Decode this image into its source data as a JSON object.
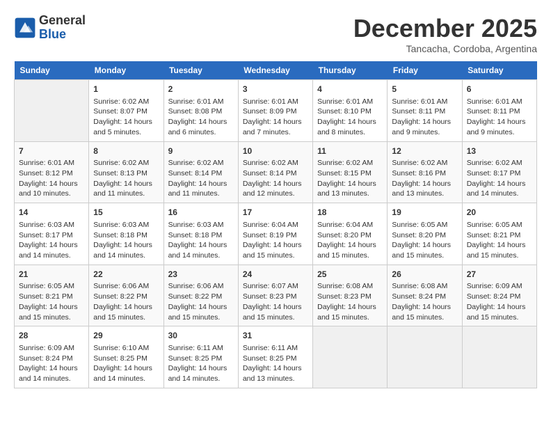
{
  "header": {
    "logo_line1": "General",
    "logo_line2": "Blue",
    "month": "December 2025",
    "location": "Tancacha, Cordoba, Argentina"
  },
  "weekdays": [
    "Sunday",
    "Monday",
    "Tuesday",
    "Wednesday",
    "Thursday",
    "Friday",
    "Saturday"
  ],
  "weeks": [
    [
      {
        "day": "",
        "info": ""
      },
      {
        "day": "1",
        "info": "Sunrise: 6:02 AM\nSunset: 8:07 PM\nDaylight: 14 hours\nand 5 minutes."
      },
      {
        "day": "2",
        "info": "Sunrise: 6:01 AM\nSunset: 8:08 PM\nDaylight: 14 hours\nand 6 minutes."
      },
      {
        "day": "3",
        "info": "Sunrise: 6:01 AM\nSunset: 8:09 PM\nDaylight: 14 hours\nand 7 minutes."
      },
      {
        "day": "4",
        "info": "Sunrise: 6:01 AM\nSunset: 8:10 PM\nDaylight: 14 hours\nand 8 minutes."
      },
      {
        "day": "5",
        "info": "Sunrise: 6:01 AM\nSunset: 8:11 PM\nDaylight: 14 hours\nand 9 minutes."
      },
      {
        "day": "6",
        "info": "Sunrise: 6:01 AM\nSunset: 8:11 PM\nDaylight: 14 hours\nand 9 minutes."
      }
    ],
    [
      {
        "day": "7",
        "info": "Sunrise: 6:01 AM\nSunset: 8:12 PM\nDaylight: 14 hours\nand 10 minutes."
      },
      {
        "day": "8",
        "info": "Sunrise: 6:02 AM\nSunset: 8:13 PM\nDaylight: 14 hours\nand 11 minutes."
      },
      {
        "day": "9",
        "info": "Sunrise: 6:02 AM\nSunset: 8:14 PM\nDaylight: 14 hours\nand 11 minutes."
      },
      {
        "day": "10",
        "info": "Sunrise: 6:02 AM\nSunset: 8:14 PM\nDaylight: 14 hours\nand 12 minutes."
      },
      {
        "day": "11",
        "info": "Sunrise: 6:02 AM\nSunset: 8:15 PM\nDaylight: 14 hours\nand 13 minutes."
      },
      {
        "day": "12",
        "info": "Sunrise: 6:02 AM\nSunset: 8:16 PM\nDaylight: 14 hours\nand 13 minutes."
      },
      {
        "day": "13",
        "info": "Sunrise: 6:02 AM\nSunset: 8:17 PM\nDaylight: 14 hours\nand 14 minutes."
      }
    ],
    [
      {
        "day": "14",
        "info": "Sunrise: 6:03 AM\nSunset: 8:17 PM\nDaylight: 14 hours\nand 14 minutes."
      },
      {
        "day": "15",
        "info": "Sunrise: 6:03 AM\nSunset: 8:18 PM\nDaylight: 14 hours\nand 14 minutes."
      },
      {
        "day": "16",
        "info": "Sunrise: 6:03 AM\nSunset: 8:18 PM\nDaylight: 14 hours\nand 14 minutes."
      },
      {
        "day": "17",
        "info": "Sunrise: 6:04 AM\nSunset: 8:19 PM\nDaylight: 14 hours\nand 15 minutes."
      },
      {
        "day": "18",
        "info": "Sunrise: 6:04 AM\nSunset: 8:20 PM\nDaylight: 14 hours\nand 15 minutes."
      },
      {
        "day": "19",
        "info": "Sunrise: 6:05 AM\nSunset: 8:20 PM\nDaylight: 14 hours\nand 15 minutes."
      },
      {
        "day": "20",
        "info": "Sunrise: 6:05 AM\nSunset: 8:21 PM\nDaylight: 14 hours\nand 15 minutes."
      }
    ],
    [
      {
        "day": "21",
        "info": "Sunrise: 6:05 AM\nSunset: 8:21 PM\nDaylight: 14 hours\nand 15 minutes."
      },
      {
        "day": "22",
        "info": "Sunrise: 6:06 AM\nSunset: 8:22 PM\nDaylight: 14 hours\nand 15 minutes."
      },
      {
        "day": "23",
        "info": "Sunrise: 6:06 AM\nSunset: 8:22 PM\nDaylight: 14 hours\nand 15 minutes."
      },
      {
        "day": "24",
        "info": "Sunrise: 6:07 AM\nSunset: 8:23 PM\nDaylight: 14 hours\nand 15 minutes."
      },
      {
        "day": "25",
        "info": "Sunrise: 6:08 AM\nSunset: 8:23 PM\nDaylight: 14 hours\nand 15 minutes."
      },
      {
        "day": "26",
        "info": "Sunrise: 6:08 AM\nSunset: 8:24 PM\nDaylight: 14 hours\nand 15 minutes."
      },
      {
        "day": "27",
        "info": "Sunrise: 6:09 AM\nSunset: 8:24 PM\nDaylight: 14 hours\nand 15 minutes."
      }
    ],
    [
      {
        "day": "28",
        "info": "Sunrise: 6:09 AM\nSunset: 8:24 PM\nDaylight: 14 hours\nand 14 minutes."
      },
      {
        "day": "29",
        "info": "Sunrise: 6:10 AM\nSunset: 8:25 PM\nDaylight: 14 hours\nand 14 minutes."
      },
      {
        "day": "30",
        "info": "Sunrise: 6:11 AM\nSunset: 8:25 PM\nDaylight: 14 hours\nand 14 minutes."
      },
      {
        "day": "31",
        "info": "Sunrise: 6:11 AM\nSunset: 8:25 PM\nDaylight: 14 hours\nand 13 minutes."
      },
      {
        "day": "",
        "info": ""
      },
      {
        "day": "",
        "info": ""
      },
      {
        "day": "",
        "info": ""
      }
    ]
  ]
}
